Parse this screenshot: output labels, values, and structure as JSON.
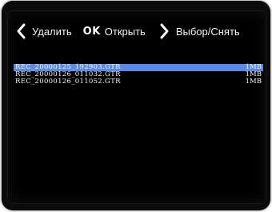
{
  "toolbar": {
    "delete_label": "Удалить",
    "ok_badge": "OK",
    "open_label": "Открыть",
    "select_label": "Выбор/Снять"
  },
  "icons": {
    "back": "chevron-left-icon",
    "forward": "chevron-right-icon"
  },
  "colors": {
    "selection": "#5a8ae6",
    "background": "#000000",
    "text": "#f5f5f5"
  },
  "files": [
    {
      "name": "REC_20000125_192903.GTR",
      "size": "1MB",
      "selected": true
    },
    {
      "name": "REC_20000126_011032.GTR",
      "size": "1MB",
      "selected": false
    },
    {
      "name": "REC_20000126_011052.GTR",
      "size": "1MB",
      "selected": false
    }
  ]
}
